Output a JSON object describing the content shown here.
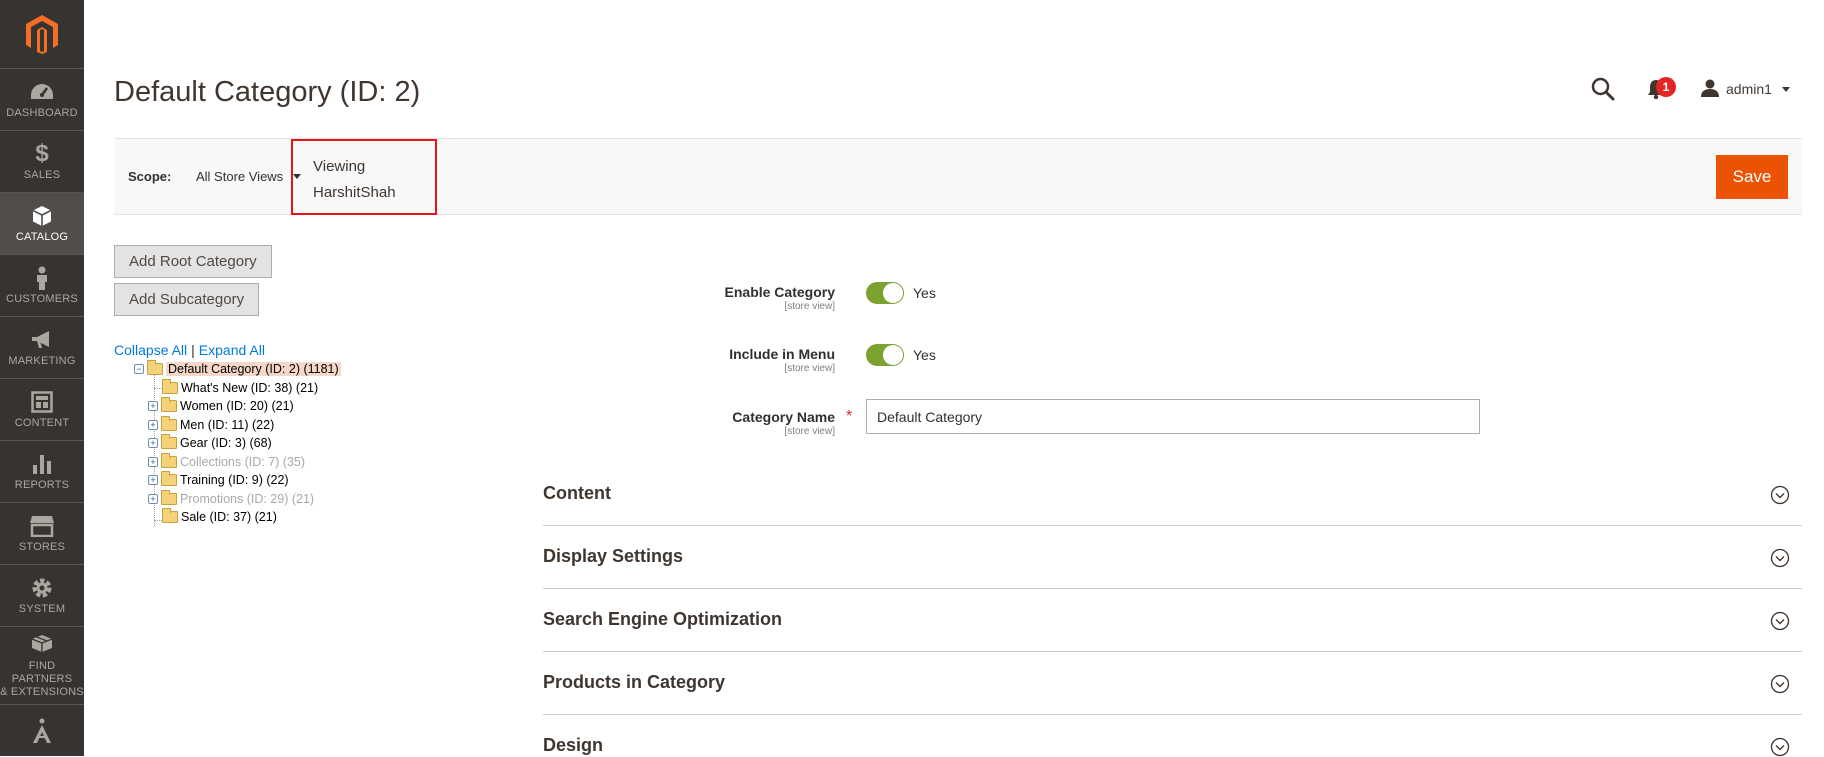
{
  "sidebar": {
    "items": [
      {
        "label": "DASHBOARD",
        "icon": "dashboard-icon"
      },
      {
        "label": "SALES",
        "icon": "dollar-icon"
      },
      {
        "label": "CATALOG",
        "icon": "box-icon",
        "active": true
      },
      {
        "label": "CUSTOMERS",
        "icon": "person-icon"
      },
      {
        "label": "MARKETING",
        "icon": "megaphone-icon"
      },
      {
        "label": "CONTENT",
        "icon": "layout-icon"
      },
      {
        "label": "REPORTS",
        "icon": "bar-chart-icon"
      },
      {
        "label": "STORES",
        "icon": "storefront-icon"
      },
      {
        "label": "SYSTEM",
        "icon": "gear-icon"
      },
      {
        "label_line1": "FIND PARTNERS",
        "label_line2": "& EXTENSIONS",
        "icon": "boxes-icon"
      }
    ]
  },
  "header": {
    "title": "Default Category (ID: 2)",
    "notifications": "1",
    "user": "admin1"
  },
  "scope": {
    "label": "Scope:",
    "selected": "All Store Views",
    "viewing_line1": "Viewing",
    "viewing_line2": "HarshitShah",
    "save": "Save"
  },
  "tree": {
    "add_root": "Add Root Category",
    "add_sub": "Add Subcategory",
    "collapse": "Collapse All",
    "separator": "|",
    "expand": "Expand All",
    "nodes": [
      {
        "label": "Default Category (ID: 2) (1181)"
      },
      {
        "label": "What's New (ID: 38) (21)"
      },
      {
        "label": "Women (ID: 20) (21)"
      },
      {
        "label": "Men (ID: 11) (22)"
      },
      {
        "label": "Gear (ID: 3) (68)"
      },
      {
        "label": "Collections (ID: 7) (35)"
      },
      {
        "label": "Training (ID: 9) (22)"
      },
      {
        "label": "Promotions (ID: 29) (21)"
      },
      {
        "label": "Sale (ID: 37) (21)"
      }
    ]
  },
  "form": {
    "enable_label": "Enable Category",
    "enable_scope": "[store view]",
    "enable_value": "Yes",
    "menu_label": "Include in Menu",
    "menu_scope": "[store view]",
    "menu_value": "Yes",
    "name_label": "Category Name",
    "name_scope": "[store view]",
    "name_required": "*",
    "name_value": "Default Category"
  },
  "sections": [
    "Content",
    "Display Settings",
    "Search Engine Optimization",
    "Products in Category",
    "Design"
  ]
}
